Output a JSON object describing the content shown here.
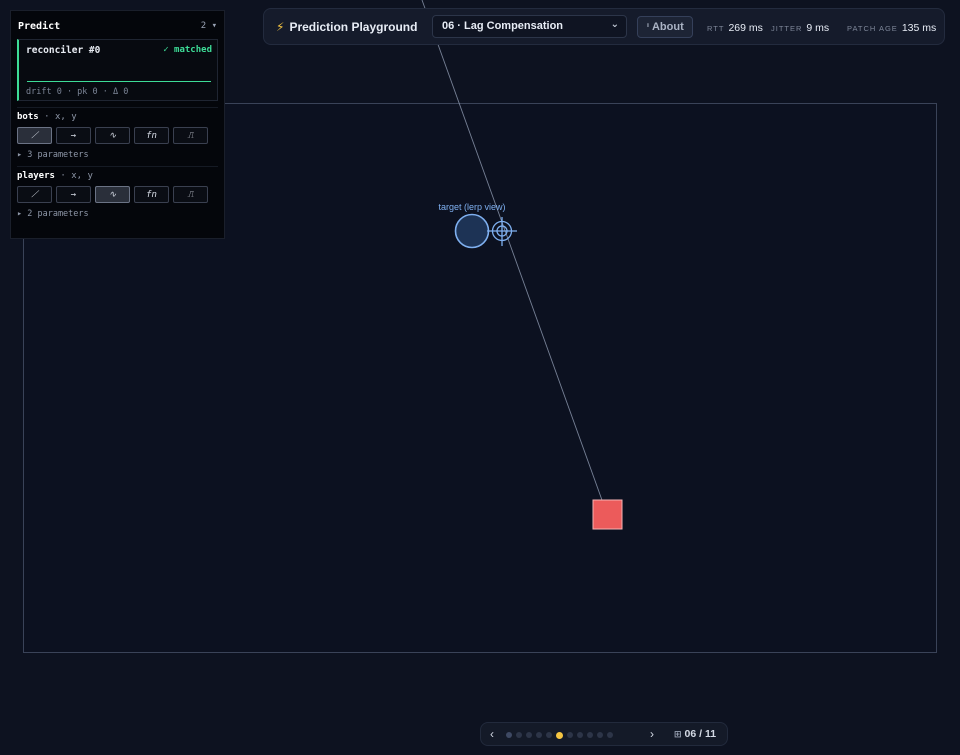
{
  "predict": {
    "title": "Predict",
    "count": "2 ▾",
    "reconciler": {
      "name": "reconciler #0",
      "status": "✓ matched",
      "stats": "drift 0 · pk 0 · Δ 0",
      "accent": "#3ddc97"
    },
    "groups": [
      {
        "name": "bots",
        "fields": "· x, y",
        "params": "▸ 3 parameters",
        "active_mode": 0
      },
      {
        "name": "players",
        "fields": "· x, y",
        "params": "▸ 2 parameters",
        "active_mode": 2
      }
    ],
    "modes": [
      {
        "icon": "linear-icon",
        "glyph": "⟋"
      },
      {
        "icon": "arrow-right-icon",
        "glyph": "→"
      },
      {
        "icon": "wave-icon",
        "glyph": "∿"
      },
      {
        "icon": "function-icon",
        "glyph": "fn"
      },
      {
        "icon": "step-icon",
        "glyph": "⎍"
      }
    ]
  },
  "toolbar": {
    "icon": "lightning-icon",
    "title": "Prediction Playground",
    "scenario": "06 · Lag Compensation",
    "about": "About",
    "rtt_label": "RTT",
    "rtt_value": "269 ms",
    "jitter_label": "JITTER",
    "jitter_value": "9 ms",
    "patch_label": "PATCH AGE",
    "patch_value": "135 ms"
  },
  "world": {
    "target_label": "target (lerp view)",
    "colors": {
      "target": "#5b8fd6",
      "player": "#e85a5a",
      "trace": "#9aa6bd"
    }
  },
  "pager": {
    "current": 6,
    "total": 11,
    "label": "06 / 11",
    "accent": "#f5c542"
  }
}
